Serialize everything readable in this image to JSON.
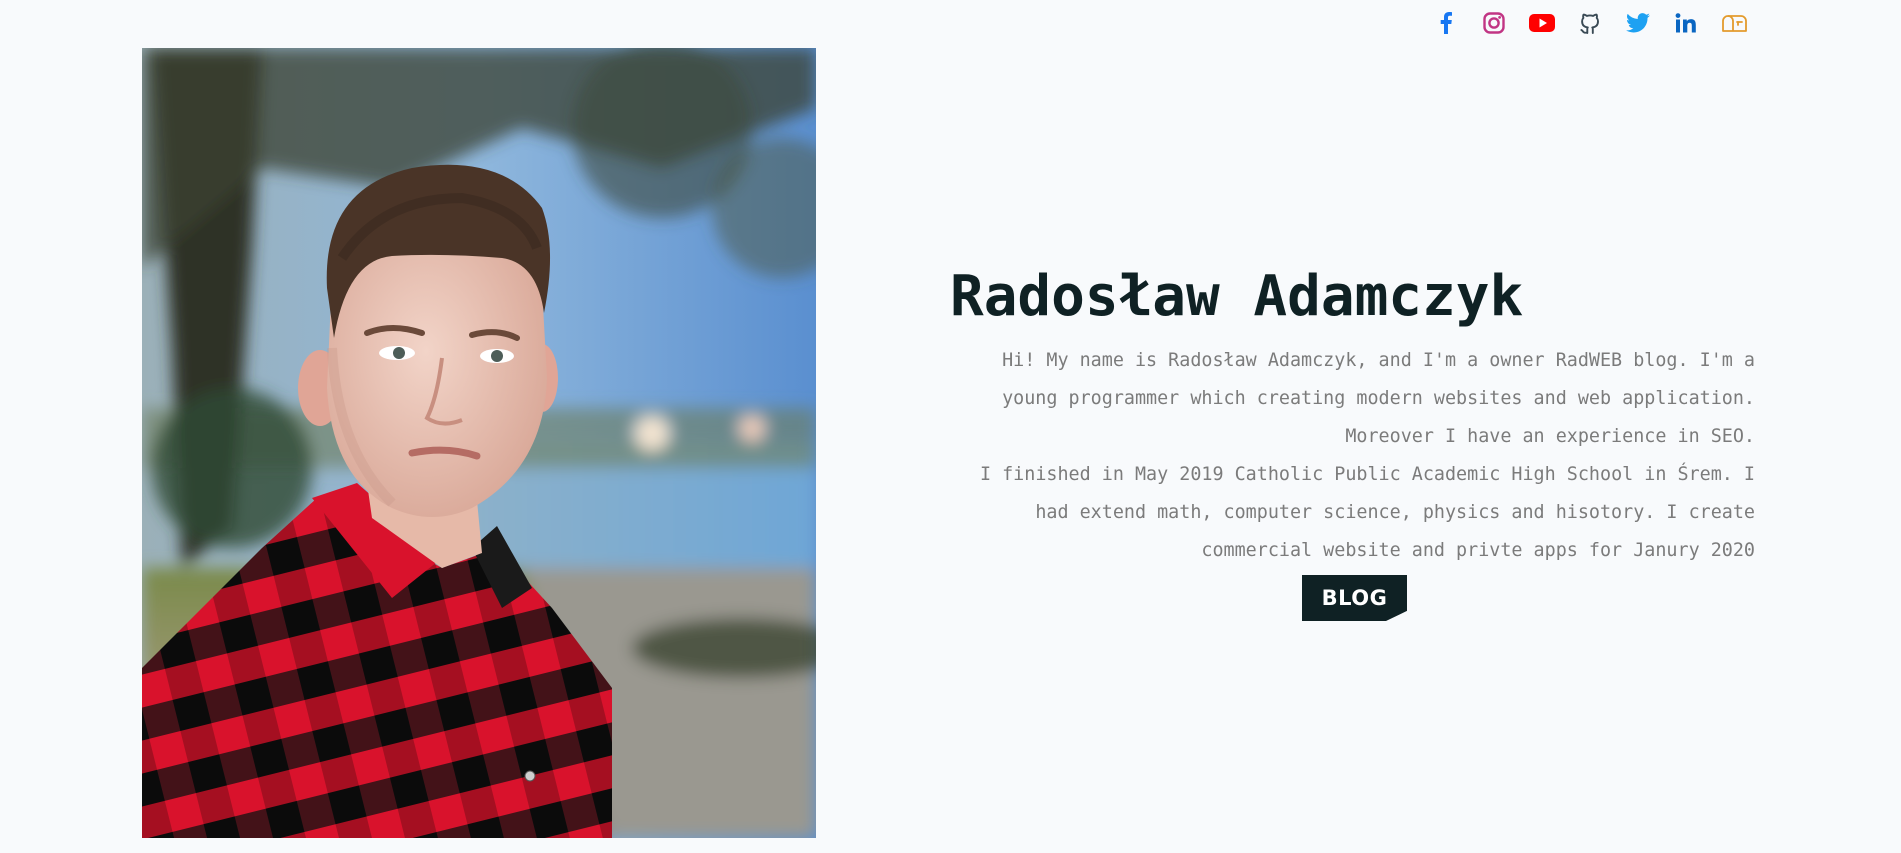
{
  "social": [
    {
      "name": "facebook",
      "icon": "facebook-icon",
      "color": "#1877f2"
    },
    {
      "name": "instagram",
      "icon": "instagram-icon",
      "color": "#c13584"
    },
    {
      "name": "youtube",
      "icon": "youtube-icon",
      "color": "#ff0000"
    },
    {
      "name": "github",
      "icon": "github-icon",
      "color": "#24292e"
    },
    {
      "name": "twitter",
      "icon": "twitter-icon",
      "color": "#1da1f2"
    },
    {
      "name": "linkedin",
      "icon": "linkedin-icon",
      "color": "#0a66c2"
    },
    {
      "name": "mailbox",
      "icon": "mailbox-icon",
      "color": "#e39b2d"
    }
  ],
  "hero": {
    "name": "Radosław Adamczyk",
    "bio_1": "Hi! My name is Radosław Adamczyk, and I'm a owner RadWEB blog. I'm a young programmer which creating modern websites and web application. Moreover I have an experience in SEO.",
    "bio_2": "I finished in May 2019 Catholic Public Academic High School in Śrem. I had extend math, computer science, physics and hisotory. I create commercial website and privte apps for Janury 2020",
    "blog_button": "BLOG"
  },
  "colors": {
    "background": "#f8fafc",
    "heading": "#0f2124",
    "body_text": "#7b7b7b",
    "button_bg": "#0f2124"
  }
}
